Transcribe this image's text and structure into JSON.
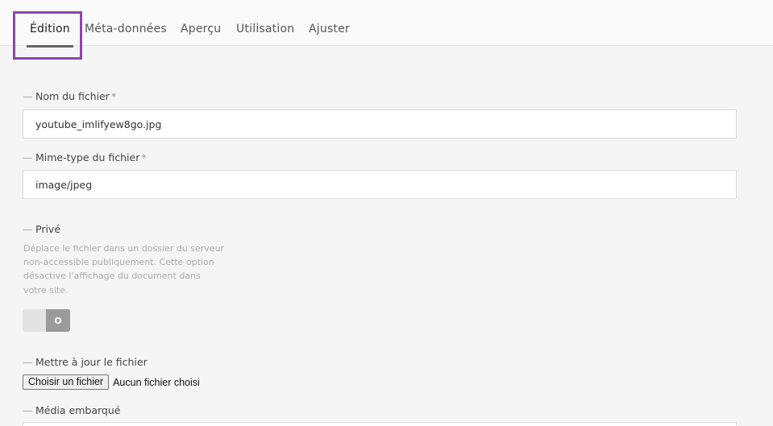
{
  "tabs": [
    {
      "label": "Édition",
      "active": true
    },
    {
      "label": "Méta-données"
    },
    {
      "label": "Aperçu"
    },
    {
      "label": "Utilisation"
    },
    {
      "label": "Ajuster"
    }
  ],
  "fields": {
    "filename": {
      "label": "Nom du fichier",
      "required_mark": "*",
      "value": "youtube_imlifyew8go.jpg"
    },
    "mimetype": {
      "label": "Mime-type du fichier",
      "required_mark": "*",
      "value": "image/jpeg"
    },
    "private": {
      "label": "Privé",
      "help": "Déplace le fichier dans un dossier du serveur non-accessible publiquement. Cette option désactive l'affichage du document dans votre site.",
      "toggle_state": "O"
    },
    "update_file": {
      "label": "Mettre à jour le fichier",
      "button_label": "Choisir un fichier",
      "status": "Aucun fichier choisi"
    },
    "embedded_media": {
      "label": "Média embarqué"
    }
  },
  "colors": {
    "highlight": "#8e44ad",
    "background": "#f5f5f5"
  }
}
